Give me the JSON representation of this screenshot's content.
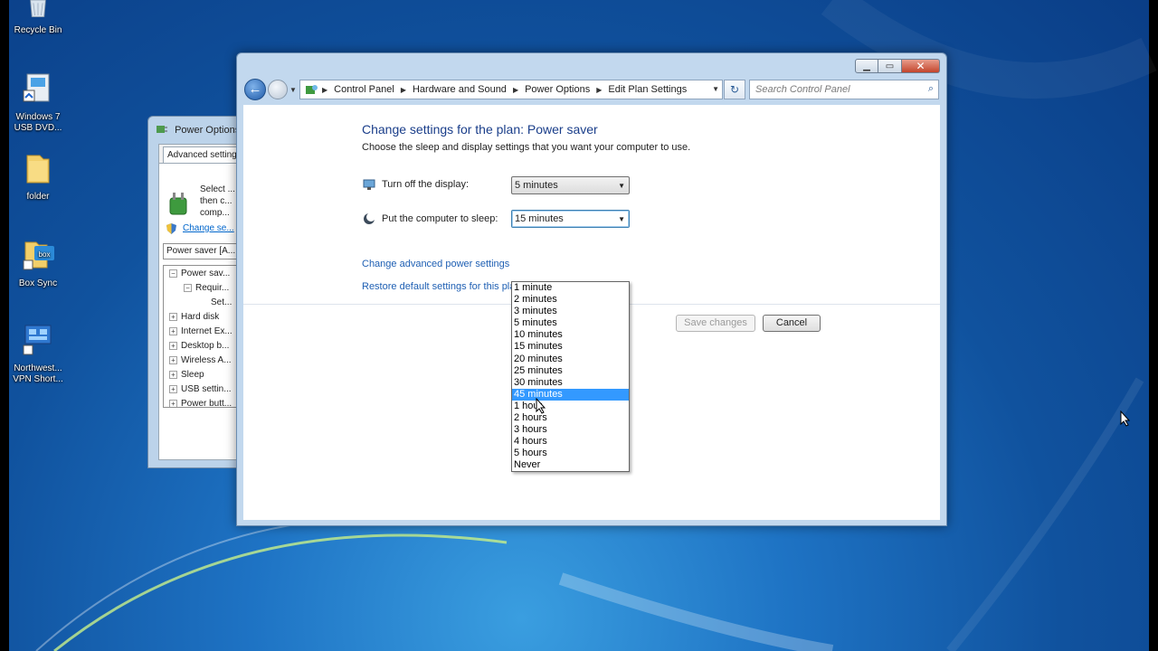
{
  "desktop": {
    "icons": [
      {
        "label": "Recycle Bin",
        "icon": "recycle-bin-icon"
      },
      {
        "label": "Windows 7 USB DVD...",
        "icon": "usb-dvd-tool-icon"
      },
      {
        "label": "folder",
        "icon": "folder-icon"
      },
      {
        "label": "Box Sync",
        "icon": "box-sync-icon"
      },
      {
        "label": "Northwest... VPN Short...",
        "icon": "vpn-shortcut-icon"
      }
    ]
  },
  "back_window": {
    "title": "Power Options",
    "tab": "Advanced settings",
    "select_text": "Select ... then c... comp...",
    "change_link": "Change se...",
    "combo": "Power saver [A...",
    "tree": [
      {
        "label": "Power sav...",
        "toggle": "−"
      },
      {
        "label": "Requir...",
        "toggle": "−"
      },
      {
        "label": "Set...",
        "toggle": ""
      },
      {
        "label": "Hard disk",
        "toggle": "+"
      },
      {
        "label": "Internet Ex...",
        "toggle": "+"
      },
      {
        "label": "Desktop b...",
        "toggle": "+"
      },
      {
        "label": "Wireless A...",
        "toggle": "+"
      },
      {
        "label": "Sleep",
        "toggle": "+"
      },
      {
        "label": "USB settin...",
        "toggle": "+"
      },
      {
        "label": "Power butt...",
        "toggle": "+"
      }
    ]
  },
  "main_window": {
    "breadcrumb": [
      "Control Panel",
      "Hardware and Sound",
      "Power Options",
      "Edit Plan Settings"
    ],
    "search_placeholder": "Search Control Panel",
    "heading": "Change settings for the plan: Power saver",
    "subheading": "Choose the sleep and display settings that you want your computer to use.",
    "display_label": "Turn off the display:",
    "display_value": "5 minutes",
    "sleep_label": "Put the computer to sleep:",
    "sleep_value": "15 minutes",
    "sleep_options": [
      "1 minute",
      "2 minutes",
      "3 minutes",
      "5 minutes",
      "10 minutes",
      "15 minutes",
      "20 minutes",
      "25 minutes",
      "30 minutes",
      "45 minutes",
      "1 hour",
      "2 hours",
      "3 hours",
      "4 hours",
      "5 hours",
      "Never"
    ],
    "highlighted_option": "45 minutes",
    "advanced_link": "Change advanced power settings",
    "restore_link": "Restore default settings for this pla",
    "save_button": "Save changes",
    "cancel_button": "Cancel",
    "accent_color": "#3399ff",
    "link_color": "#1e5fb3",
    "heading_color": "#1a3e8a"
  }
}
